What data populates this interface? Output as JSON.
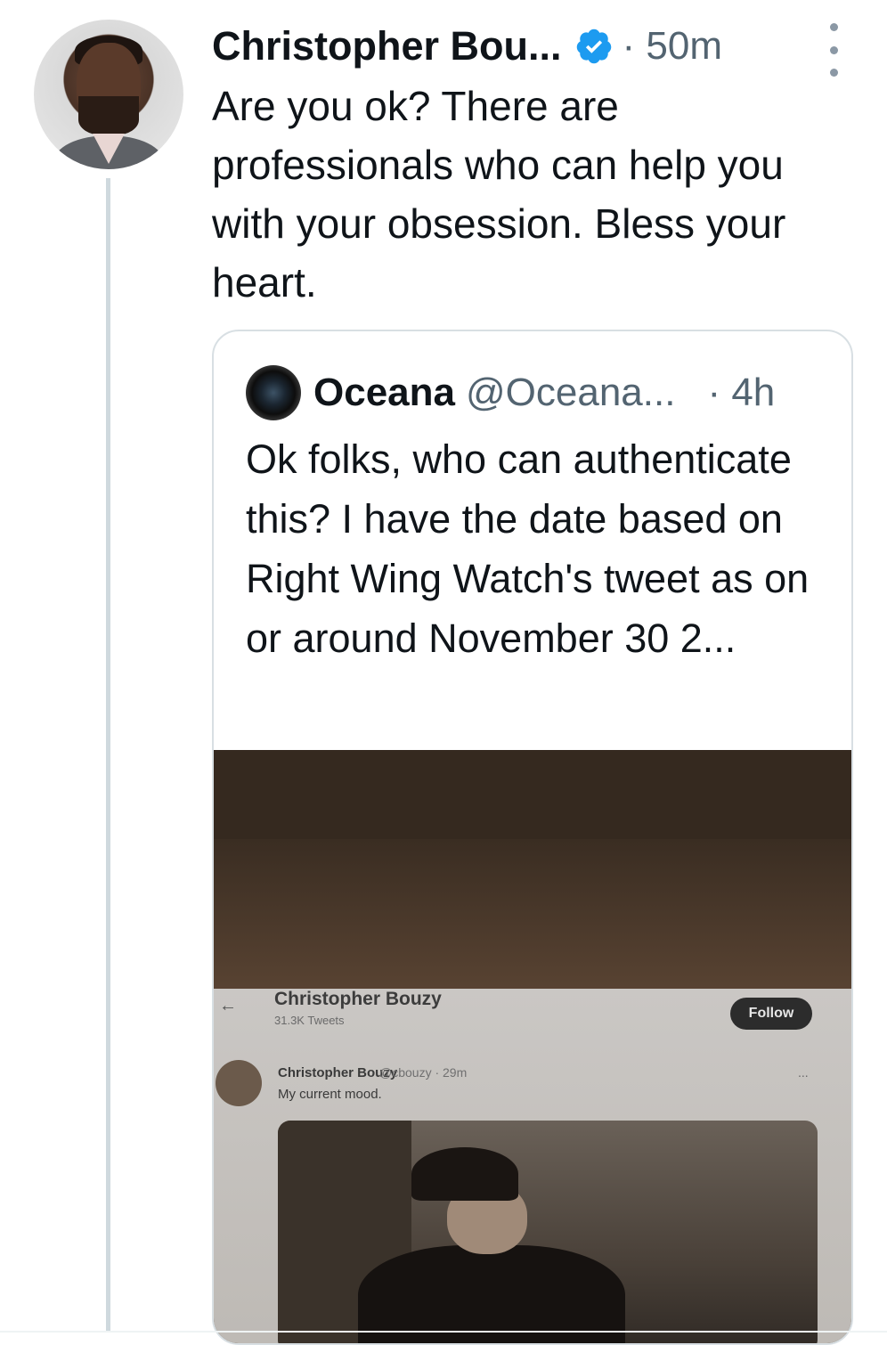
{
  "tweet": {
    "author_name": "Christopher Bou...",
    "time": "· 50m",
    "text": "Are you ok? There are professionals who can help you with your obsession. Bless your heart.",
    "verified_icon": "verified-badge-icon",
    "more_icon": "more-vertical-icon"
  },
  "quote": {
    "author_name": "Oceana",
    "handle": "@Oceana...",
    "time": "· 4h",
    "text": "Ok folks, who can authenticate this? I have the date based on Right Wing Watch's tweet as on or around November 30 2...",
    "media": {
      "screen": {
        "back_icon": "←",
        "profile_name": "Christopher Bouzy",
        "tweet_count": "31.3K Tweets",
        "follow_label": "Follow",
        "tweet_name": "Christopher Bouzy",
        "tweet_handle": "@cbouzy · 29m",
        "tweet_text": "My current mood.",
        "tweet_more": "..."
      }
    }
  },
  "colors": {
    "text": "#0f1419",
    "secondary": "#536471",
    "verified": "#1d9bf0",
    "thread_line": "#cfd9de",
    "border": "#d8dfe3"
  }
}
